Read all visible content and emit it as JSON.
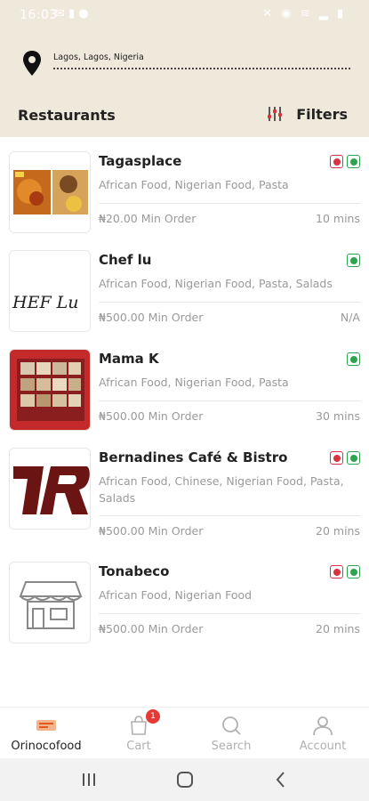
{
  "status_bar": {
    "time": "16:03"
  },
  "header": {
    "location": "Lagos, Lagos, Nigeria",
    "title": "Restaurants",
    "filters_label": "Filters"
  },
  "restaurants": [
    {
      "name": "Tagasplace",
      "cuisine": "African Food, Nigerian Food, Pasta",
      "min_order": "₦20.00 Min Order",
      "eta": "10 mins",
      "badges": [
        "nonveg",
        "veg"
      ]
    },
    {
      "name": "Chef lu",
      "cuisine": "African Food, Nigerian Food, Pasta, Salads",
      "min_order": "₦500.00 Min Order",
      "eta": "N/A",
      "badges": [
        "veg"
      ],
      "logo_text": "HEF Lu"
    },
    {
      "name": "Mama K",
      "cuisine": "African Food, Nigerian Food, Pasta",
      "min_order": "₦500.00 Min Order",
      "eta": "30 mins",
      "badges": [
        "veg"
      ]
    },
    {
      "name": "Bernadines Café & Bistro",
      "cuisine": "African Food, Chinese, Nigerian Food, Pasta, Salads",
      "min_order": "₦500.00 Min Order",
      "eta": "20 mins",
      "badges": [
        "nonveg",
        "veg"
      ]
    },
    {
      "name": "Tonabeco",
      "cuisine": "African Food, Nigerian Food",
      "min_order": "₦500.00 Min Order",
      "eta": "20 mins",
      "badges": [
        "nonveg",
        "veg"
      ]
    }
  ],
  "tabs": [
    {
      "label": "Orinocofood",
      "icon": "home-logo-icon",
      "active": true
    },
    {
      "label": "Cart",
      "icon": "cart-icon",
      "badge": "1"
    },
    {
      "label": "Search",
      "icon": "search-icon"
    },
    {
      "label": "Account",
      "icon": "account-icon"
    }
  ],
  "colors": {
    "header_bg": "#efe9dc",
    "veg": "#2ea44f",
    "nonveg": "#d9333f",
    "badge_red": "#e53935"
  }
}
